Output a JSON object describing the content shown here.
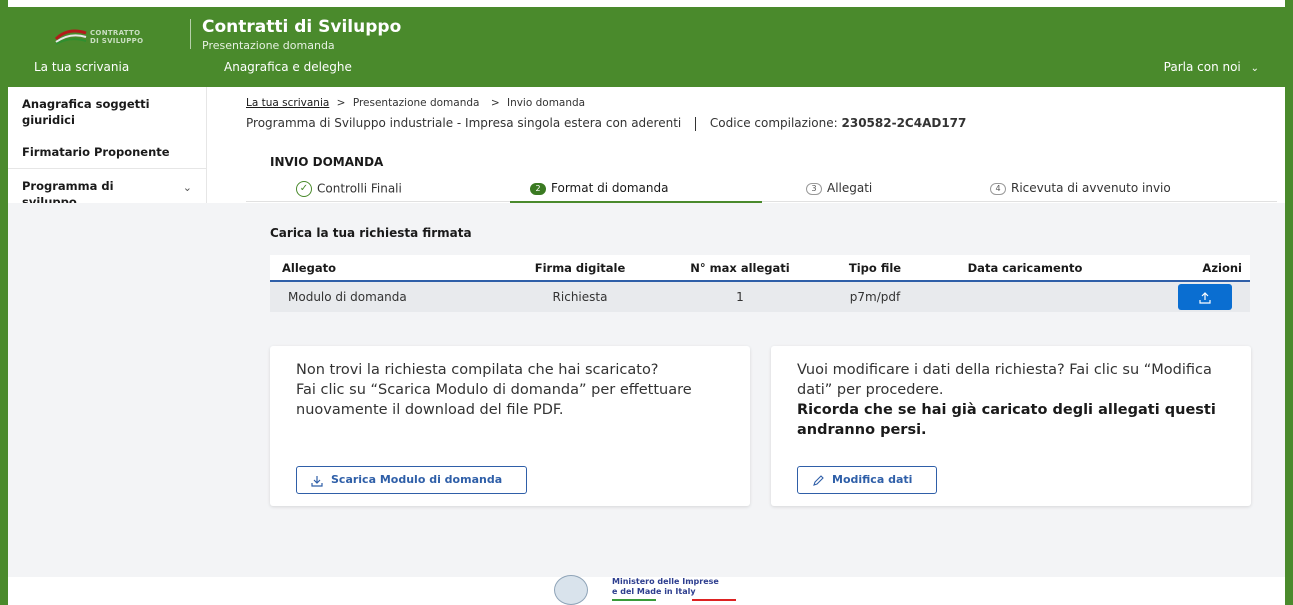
{
  "header": {
    "logo_line1": "CONTRATTO",
    "logo_line2": "DI SVILUPPO",
    "title": "Contratti di Sviluppo",
    "subtitle": "Presentazione domanda",
    "nav": [
      "La tua scrivania",
      "Anagrafica e deleghe"
    ],
    "talk": "Parla con noi"
  },
  "sidebar": {
    "items": [
      {
        "label": "Anagrafica soggetti giuridici"
      },
      {
        "label": "Firmatario Proponente"
      },
      {
        "label": "Programma di sviluppo"
      }
    ]
  },
  "breadcrumb": {
    "home": "La tua scrivania",
    "sep1": ">",
    "page": "Presentazione domanda",
    "sep2": ">",
    "current": "Invio domanda"
  },
  "program": {
    "text": "Programma di Sviluppo industriale  -  Impresa singola estera con aderenti",
    "code_label": "Codice compilazione:",
    "code": "230582-2C4AD177"
  },
  "card": {
    "title": "INVIO DOMANDA",
    "steps": [
      {
        "num": "",
        "label": "Controlli Finali"
      },
      {
        "num": "2",
        "label": "Format di domanda"
      },
      {
        "num": "3",
        "label": "Allegati"
      },
      {
        "num": "4",
        "label": "Ricevuta di avvenuto invio"
      }
    ],
    "upload_heading": "Carica la tua richiesta firmata",
    "table": {
      "headers": [
        "Allegato",
        "Firma digitale",
        "N° max allegati",
        "Tipo file",
        "Data caricamento",
        "Azioni"
      ],
      "rows": [
        [
          "Modulo di domanda",
          "Richiesta",
          "1",
          "p7m/pdf",
          ""
        ]
      ]
    },
    "box_left": {
      "text1": "Non trovi la richiesta compilata che hai scaricato?",
      "text2": "Fai clic su “Scarica Modulo di domanda” per effettuare nuovamente il download del file PDF.",
      "button": "Scarica Modulo di domanda"
    },
    "box_right": {
      "text1": "Vuoi modificare i dati della richiesta? Fai clic su “Modifica dati” per procedere.",
      "text2": "Ricorda che se hai già caricato degli allegati questi andranno persi.",
      "button": "Modifica dati"
    }
  },
  "footer": {
    "ministry_line1": "Ministero delle Imprese",
    "ministry_line2": "e del Made in Italy"
  },
  "colors": {
    "brand_green": "#4a8a2c",
    "action_blue": "#0a6ed1",
    "link_blue": "#2f5fa8"
  }
}
